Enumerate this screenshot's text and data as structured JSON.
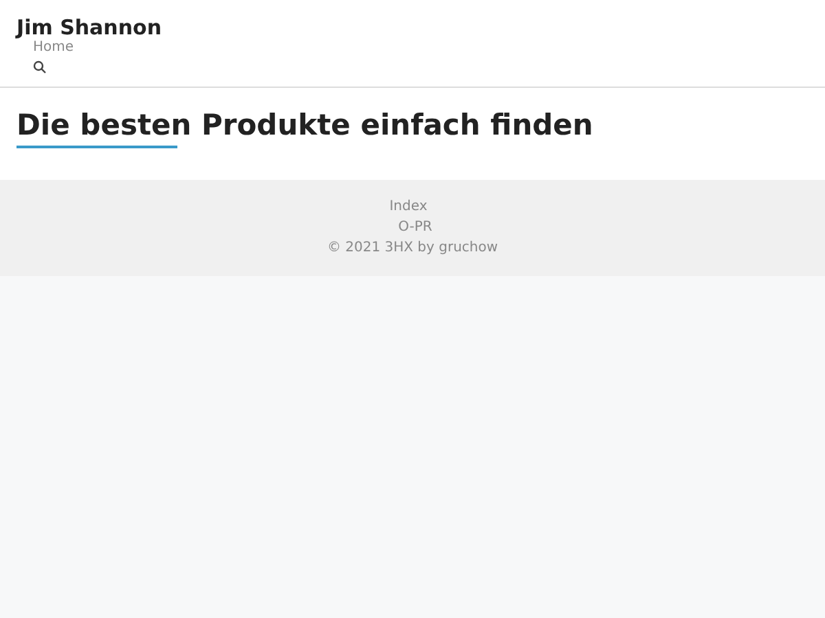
{
  "header": {
    "site_title": "Jim Shannon",
    "nav": [
      {
        "label": "Home"
      }
    ]
  },
  "page": {
    "title": "Die besten Produkte einfach finden"
  },
  "footer": {
    "links": [
      "Index",
      "O-PR"
    ],
    "copyright": "© 2021 3HX by gruchow"
  }
}
